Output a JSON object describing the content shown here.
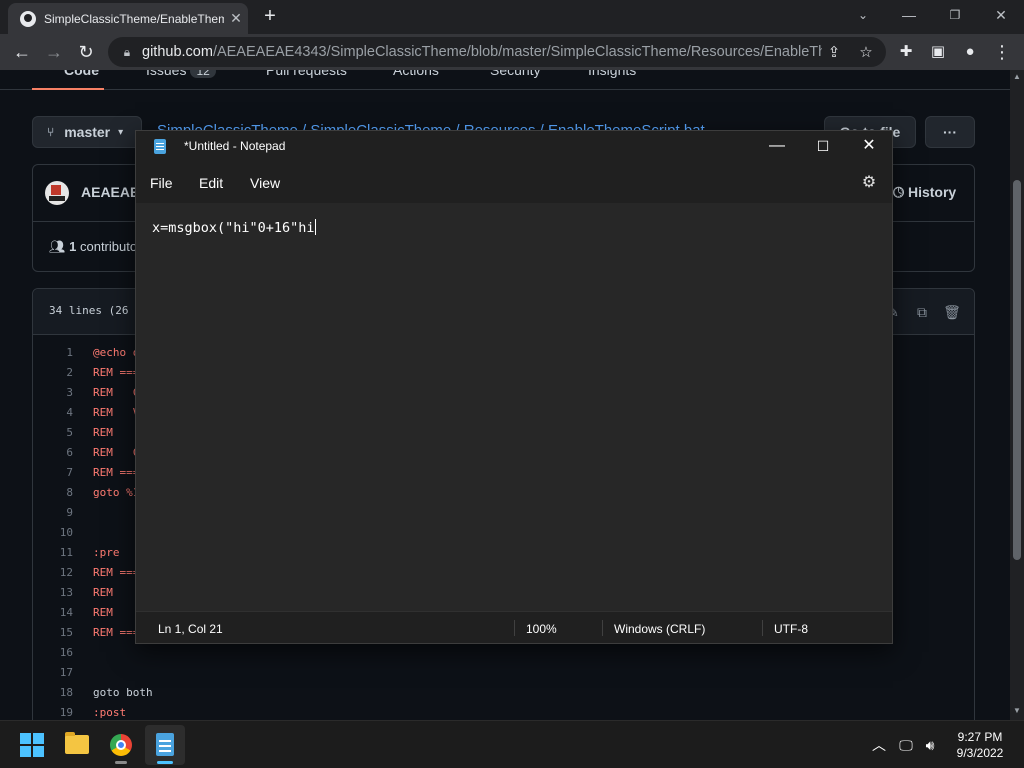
{
  "browser": {
    "tab_title": "SimpleClassicTheme/EnableThem",
    "new_tab_glyph": "+",
    "url_host": "github.com",
    "url_path": "/AEAEAEAE4343/SimpleClassicTheme/blob/master/SimpleClassicTheme/Resources/EnableThem..."
  },
  "github": {
    "nav": {
      "code": "Code",
      "issues": "Issues",
      "issues_count": "12",
      "pull_requests": "Pull requests",
      "actions": "Actions",
      "security": "Security",
      "insights": "Insights"
    },
    "branch": "master",
    "breadcrumb": "SimpleClassicTheme / SimpleClassicTheme / Resources / EnableThemeScript.bat",
    "go_to_file": "Go to file",
    "more": "···",
    "commit_author": "AEAEAEA",
    "history": "History",
    "contributors_count": "1",
    "contributors_label": "contributor",
    "file_meta": "34 lines (26",
    "code_lines": [
      {
        "n": "1",
        "text": "@echo o",
        "kw": true
      },
      {
        "n": "2",
        "text": "REM ===",
        "kw": true
      },
      {
        "n": "3",
        "text": "REM   C",
        "kw": true
      },
      {
        "n": "4",
        "text": "REM   V",
        "kw": true
      },
      {
        "n": "5",
        "text": "REM",
        "kw": true
      },
      {
        "n": "6",
        "text": "REM   C",
        "kw": true
      },
      {
        "n": "7",
        "text": "REM ===",
        "kw": true
      },
      {
        "n": "8",
        "text": "goto %1",
        "kw": true
      },
      {
        "n": "9",
        "text": "",
        "kw": false
      },
      {
        "n": "10",
        "text": "",
        "kw": false
      },
      {
        "n": "11",
        "text": ":pre",
        "kw": true
      },
      {
        "n": "12",
        "text": "REM ===",
        "kw": true
      },
      {
        "n": "13",
        "text": "REM",
        "kw": true
      },
      {
        "n": "14",
        "text": "REM",
        "kw": true
      },
      {
        "n": "15",
        "text": "REM ===",
        "kw": true
      },
      {
        "n": "16",
        "text": "",
        "kw": false
      },
      {
        "n": "17",
        "text": "",
        "kw": false
      },
      {
        "n": "18",
        "text": "goto both",
        "kw": false
      },
      {
        "n": "19",
        "text": ":post",
        "kw": true
      }
    ]
  },
  "notepad": {
    "title": "*Untitled - Notepad",
    "menu": {
      "file": "File",
      "edit": "Edit",
      "view": "View"
    },
    "content": "x=msgbox(\"hi\"0+16\"hi",
    "status": {
      "position": "Ln 1, Col 21",
      "zoom": "100%",
      "line_ending": "Windows (CRLF)",
      "encoding": "UTF-8"
    }
  },
  "taskbar": {
    "time": "9:27 PM",
    "date": "9/3/2022"
  },
  "icons": {
    "win_minimize": "minimize-icon",
    "win_maximize": "maximize-icon",
    "win_close": "close-icon"
  },
  "colors": {
    "github_link": "#58a6ff",
    "code_keyword": "#ff7b72",
    "taskbar_accent": "#4cc2ff"
  }
}
